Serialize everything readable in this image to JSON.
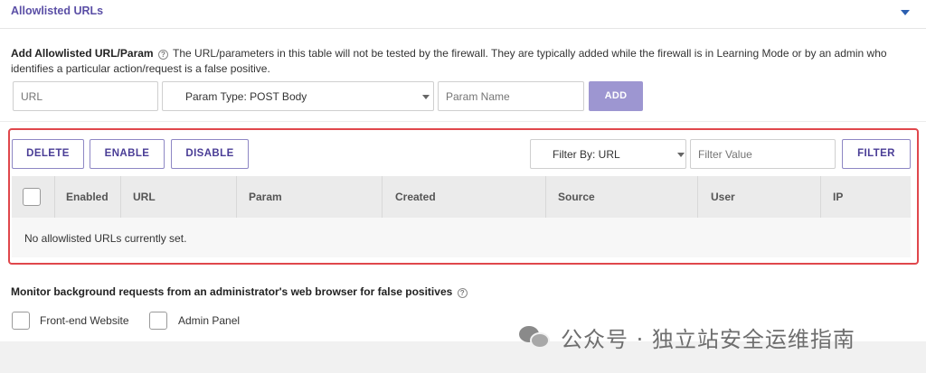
{
  "section": {
    "title": "Allowlisted URLs"
  },
  "add_form": {
    "title": "Add Allowlisted URL/Param",
    "help_glyph": "?",
    "description": "The URL/parameters in this table will not be tested by the firewall. They are typically added while the firewall is in Learning Mode or by an admin who identifies a particular action/request is a false positive.",
    "url_placeholder": "URL",
    "param_type_selected": "Param Type: POST Body",
    "param_name_placeholder": "Param Name",
    "add_label": "ADD"
  },
  "toolbar": {
    "delete_label": "DELETE",
    "enable_label": "ENABLE",
    "disable_label": "DISABLE",
    "filter_by_selected": "Filter By: URL",
    "filter_value_placeholder": "Filter Value",
    "filter_label": "FILTER"
  },
  "table": {
    "columns": [
      "Enabled",
      "URL",
      "Param",
      "Created",
      "Source",
      "User",
      "IP"
    ],
    "rows": [],
    "empty_message": "No allowlisted URLs currently set."
  },
  "monitor": {
    "title": "Monitor background requests from an administrator's web browser for false positives",
    "help_glyph": "?",
    "options": [
      {
        "label": "Front-end Website",
        "checked": false
      },
      {
        "label": "Admin Panel",
        "checked": false
      }
    ]
  },
  "watermark": {
    "text": "公众号 · 独立站安全运维指南",
    "icon": "wechat-icon"
  },
  "colors": {
    "accent": "#5b4fa6",
    "add_button": "#9d96d1",
    "highlight_border": "#e0474c",
    "caret": "#2c5fb0"
  }
}
